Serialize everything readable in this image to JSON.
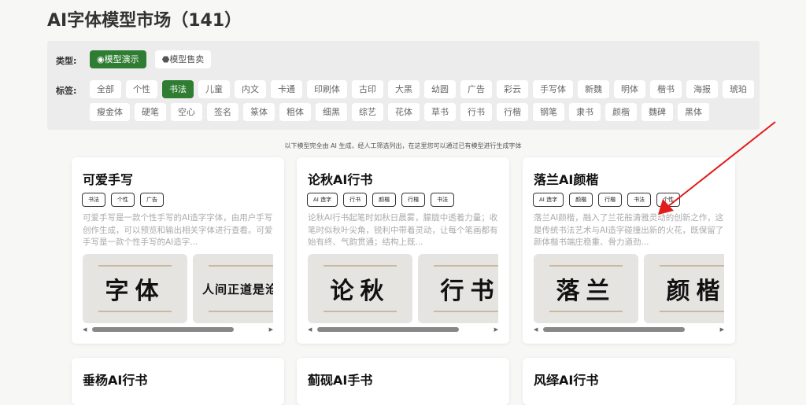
{
  "page_title": "AI字体模型市场（141）",
  "filters": {
    "type_label": "类型:",
    "types": [
      {
        "label": "模型演示",
        "icon": "eye-icon",
        "active": true
      },
      {
        "label": "模型售卖",
        "icon": "tag-icon",
        "active": false
      }
    ],
    "tag_label": "标签:",
    "tags": [
      "全部",
      "个性",
      "书法",
      "儿童",
      "内文",
      "卡通",
      "印刷体",
      "古印",
      "大黑",
      "幼圆",
      "广告",
      "彩云",
      "手写体",
      "新魏",
      "明体",
      "楷书",
      "海报",
      "琥珀",
      "瘦金体",
      "硬笔",
      "空心",
      "签名",
      "篆体",
      "粗体",
      "细黑",
      "综艺",
      "花体",
      "草书",
      "行书",
      "行楷",
      "钢笔",
      "隶书",
      "颜楷",
      "魏碑",
      "黑体"
    ],
    "active_tag": "书法",
    "accent": "#2e7d32"
  },
  "note": "以下模型完全由 AI 生成，经人工筛选列出，在这里您可以通过已有模型进行生成字体",
  "cards": [
    {
      "title": "可爱手写",
      "tags": [
        "书法",
        "个性",
        "广告"
      ],
      "desc": "可爱手写是一款个性手写的AI造字字体，由用户手写创作生成，可以预览和输出相关字体进行查看。可爱手写是一款个性手写的AI造字...",
      "previews": [
        "字体",
        "人间正道是沧"
      ]
    },
    {
      "title": "论秋AI行书",
      "tags": [
        "AI 造字",
        "行书",
        "颜楷",
        "行楷",
        "书法"
      ],
      "desc": "论秋AI行书起笔时如秋日晨雾，朦胧中透着力量；收笔时似秋叶尖角，锐利中带着灵动，让每个笔画都有始有终、气韵贯通；结构上既...",
      "previews": [
        "论秋",
        "行书"
      ]
    },
    {
      "title": "落兰AI颜楷",
      "tags": [
        "AI 造字",
        "颜楷",
        "行楷",
        "书法",
        "个性"
      ],
      "desc": "落兰AI颜楷，融入了兰花般清雅灵动的创新之作，这是传统书法艺术与AI造字碰撞出新的火花，既保留了颜体楷书端庄稳重、骨力遒劲...",
      "previews": [
        "落兰",
        "颜楷"
      ]
    },
    {
      "title": "垂杨AI行书"
    },
    {
      "title": "蓟砚AI手书"
    },
    {
      "title": "风绎AI行书"
    }
  ]
}
